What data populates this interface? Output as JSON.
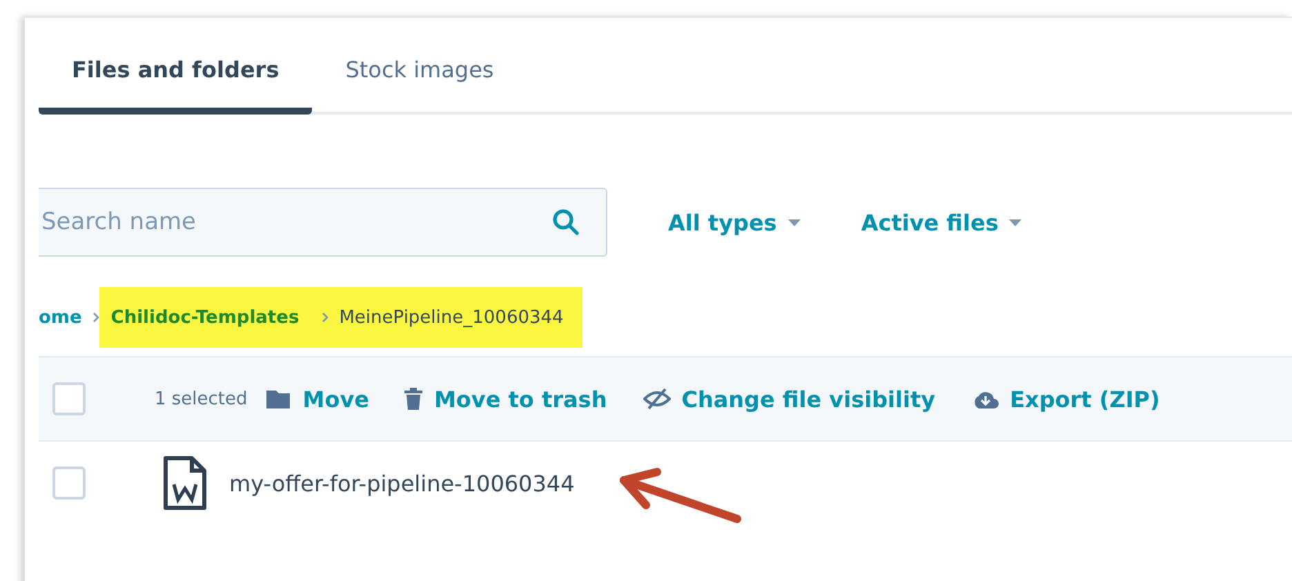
{
  "tabs": [
    {
      "label": "Files and folders",
      "selected": true
    },
    {
      "label": "Stock images",
      "selected": false
    }
  ],
  "search": {
    "placeholder": "Search name"
  },
  "filters": [
    {
      "label": "All types"
    },
    {
      "label": "Active files"
    }
  ],
  "breadcrumb": [
    {
      "label": "ome",
      "kind": "link",
      "highlighted": false
    },
    {
      "label": "Chilidoc-Templates",
      "kind": "folder",
      "highlighted": true
    },
    {
      "label": "MeinePipeline_10060344",
      "kind": "current",
      "highlighted": true
    }
  ],
  "bulk_bar": {
    "checked": false,
    "count": "1 selected",
    "actions": [
      {
        "label": "Move",
        "kind": "move"
      },
      {
        "label": "Move to trash",
        "kind": "trash"
      },
      {
        "label": "Change file visibility",
        "kind": "visibility"
      },
      {
        "label": "Export (ZIP)",
        "kind": "export"
      }
    ]
  },
  "files": [
    {
      "name": "my-offer-for-pipeline-10060344",
      "checked": false,
      "kind": "word",
      "annotated": true
    }
  ]
}
